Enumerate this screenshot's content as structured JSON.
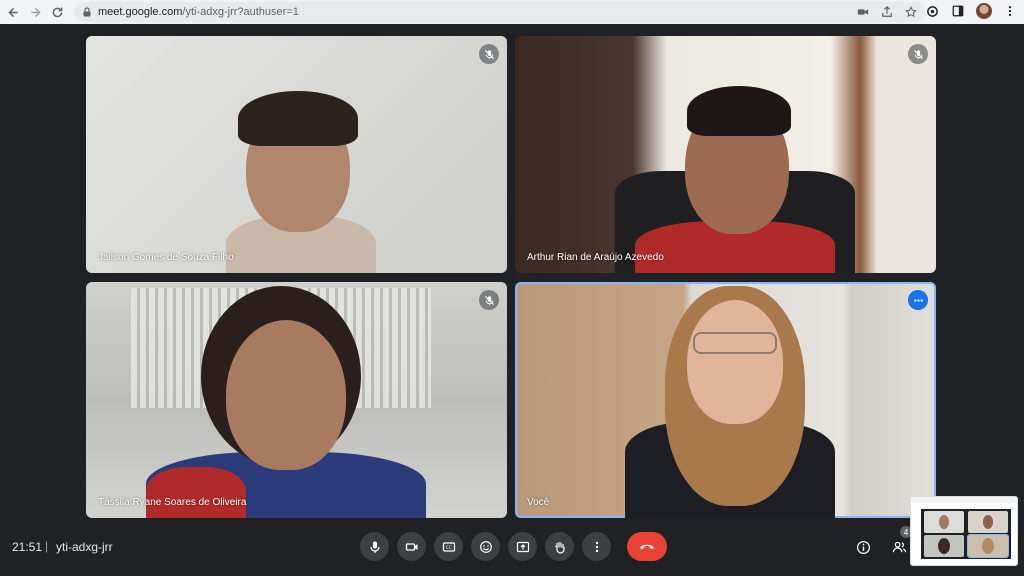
{
  "browser": {
    "url_host": "meet.google.com",
    "url_path": "/yti-adxg-jrr?authuser=1"
  },
  "participants": [
    {
      "name": "Jailson Gomes de Souza Filho",
      "muted": true
    },
    {
      "name": "Arthur Rian de Araújo Azevedo",
      "muted": true
    },
    {
      "name": "Tássila Ryane Soares de Oliveira",
      "muted": true
    },
    {
      "name": "Você",
      "muted": false,
      "active": true
    }
  ],
  "meeting": {
    "time": "21:51",
    "separator": "|",
    "code": "yti-adxg-jrr",
    "people_count": "4"
  },
  "controls": [
    "microphone-icon",
    "camera-icon",
    "captions-icon",
    "emoji-icon",
    "present-icon",
    "raise-hand-icon",
    "more-options-icon",
    "end-call-icon"
  ],
  "colors": {
    "background": "#202124",
    "control_bg": "#3c4043",
    "end_call": "#ea4335",
    "active_outline": "#8ab4f8",
    "accent": "#1a73e8"
  }
}
